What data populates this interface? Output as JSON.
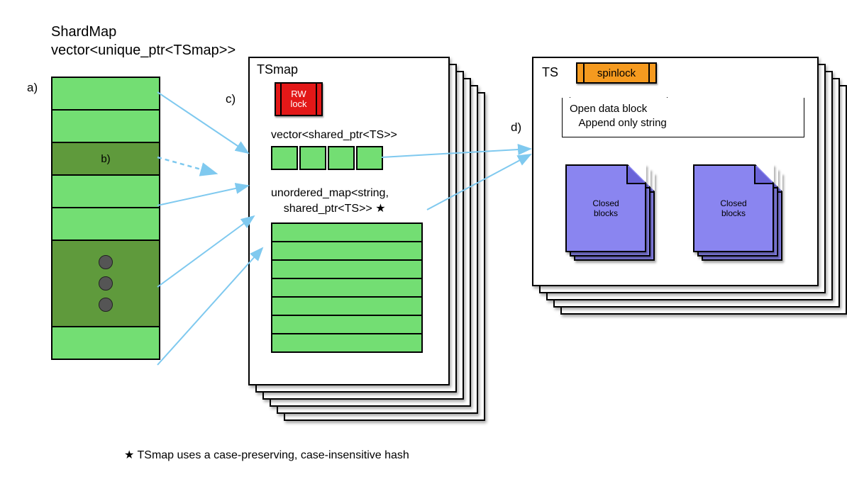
{
  "title": {
    "line1": "ShardMap",
    "line2": "vector<unique_ptr<TSmap>>"
  },
  "labels": {
    "a": "a)",
    "b": "b)",
    "c": "c)",
    "d": "d)"
  },
  "tsmap": {
    "title": "TSmap",
    "rwlock": "RW\nlock",
    "vector_label": "vector<shared_ptr<TS>>",
    "map_label_line1": "unordered_map<string,",
    "map_label_line2": "shared_ptr<TS>> ★",
    "small_box_count": 4,
    "map_row_count": 7
  },
  "ts": {
    "title": "TS",
    "spinlock": "spinlock",
    "open_block_line1": "Open data block",
    "open_block_line2": "Append only string",
    "closed_blocks_label": "Closed\nblocks"
  },
  "footnote": "★ TSmap uses a case-preserving, case-insensitive hash",
  "shard_cell_count_top": 2,
  "shard_cell_count_mid": 2,
  "stack_depth": 6
}
